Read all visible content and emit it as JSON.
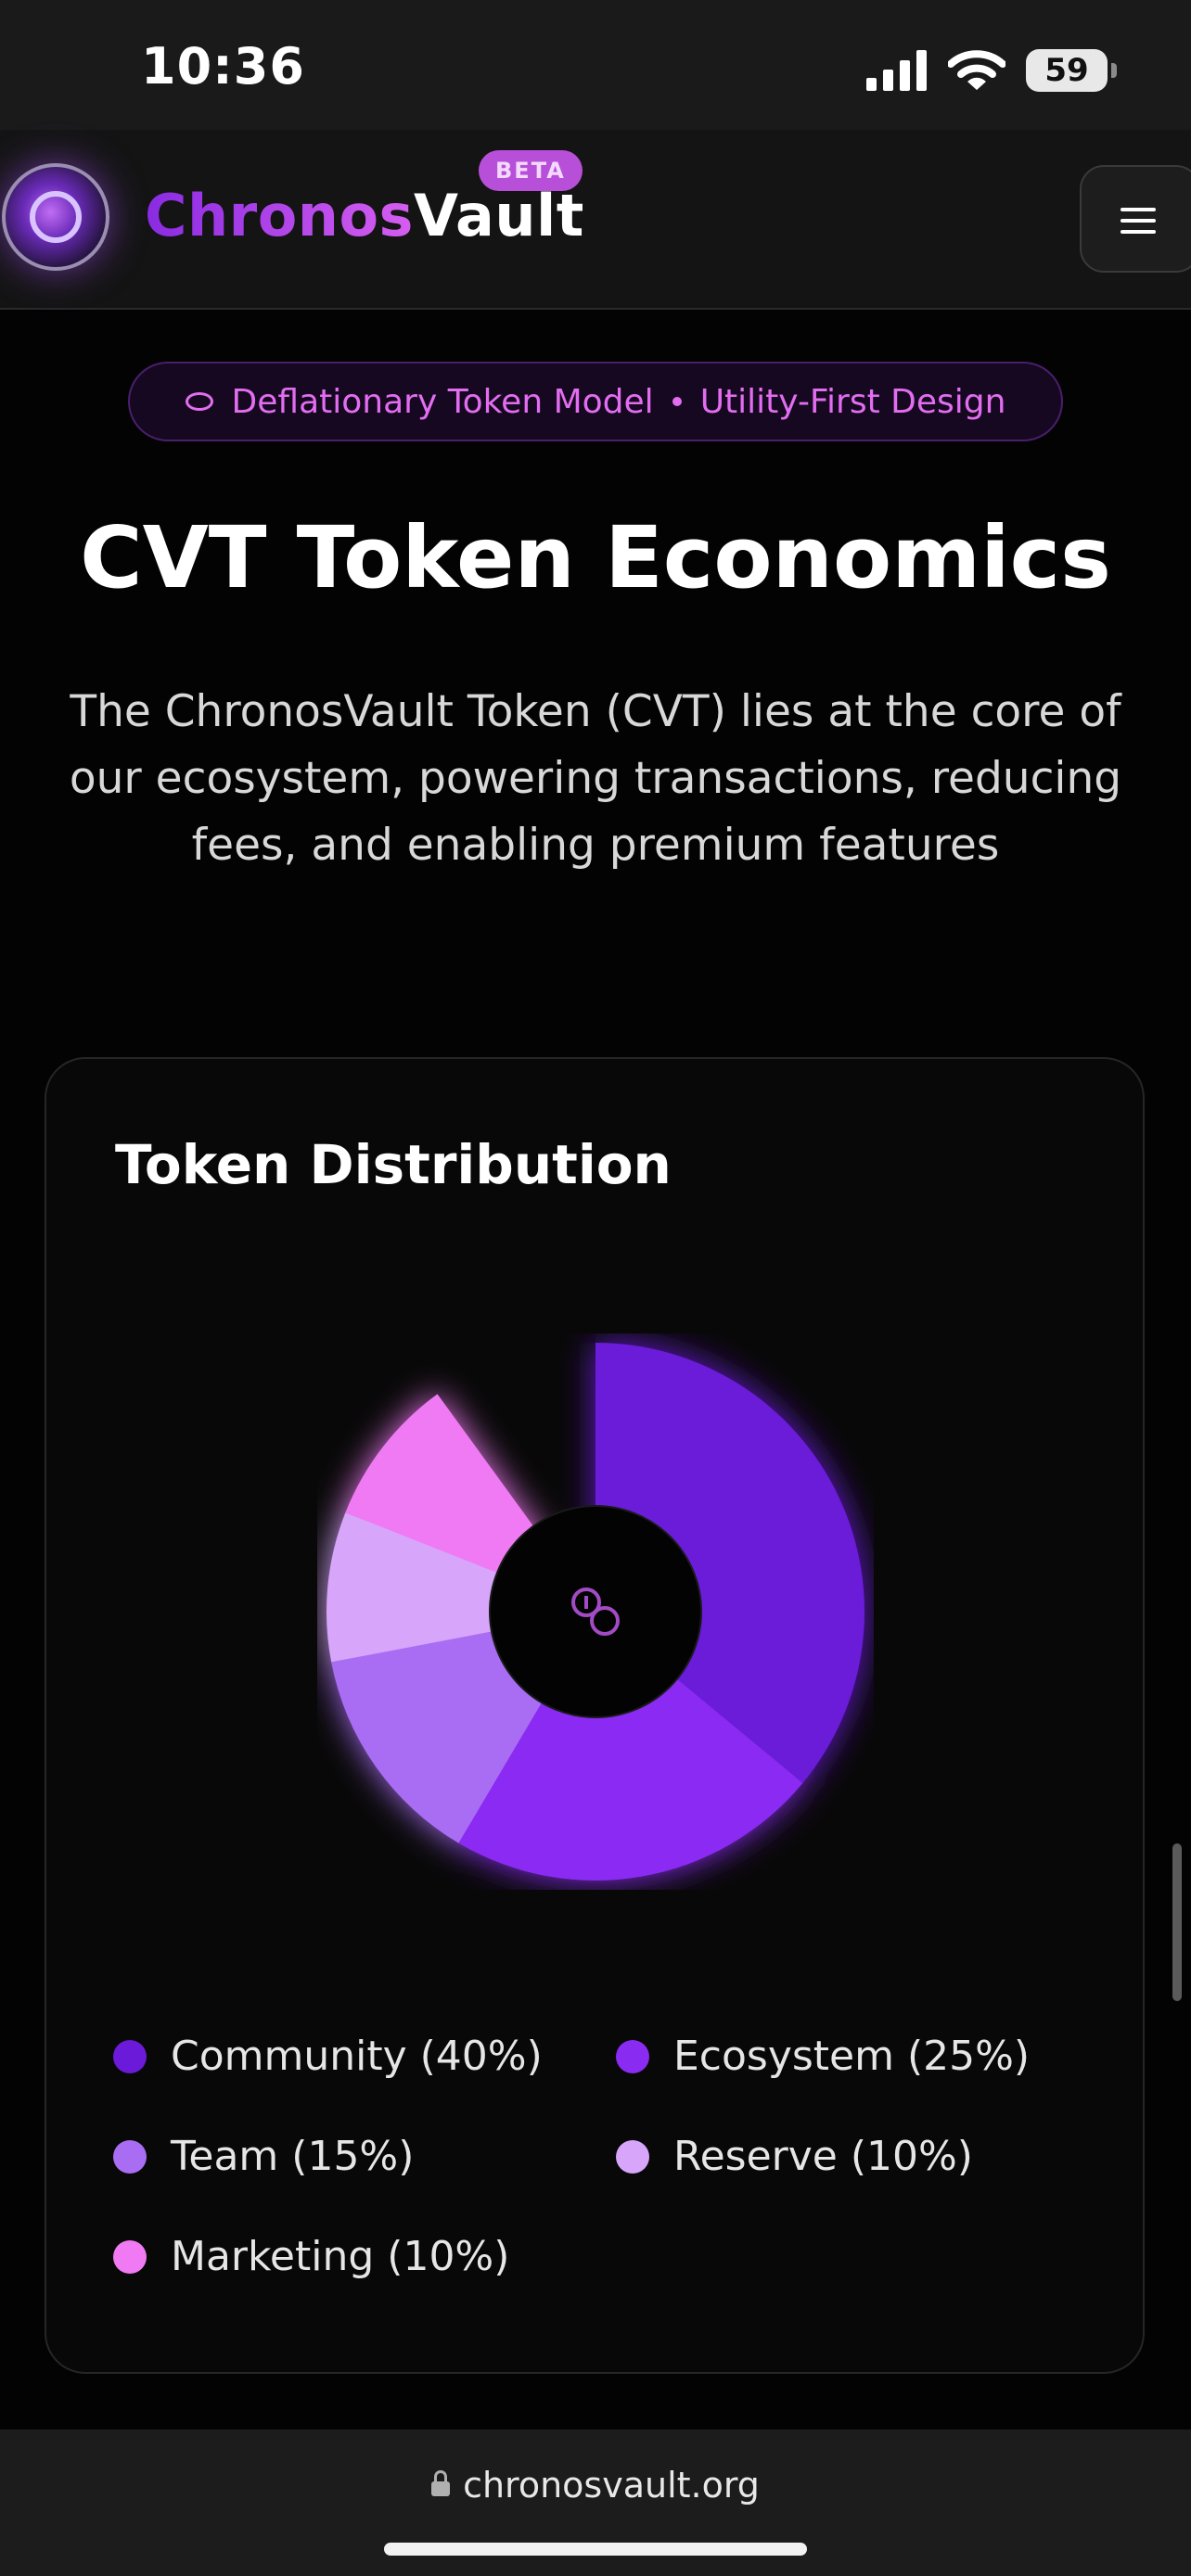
{
  "status_bar": {
    "time": "10:36",
    "battery": "59"
  },
  "header": {
    "brand_part1": "Chronos",
    "brand_part2": "Vault",
    "badge": "BETA"
  },
  "hero": {
    "badge_left": "Deflationary Token Model",
    "badge_right": "Utility-First Design",
    "title": "CVT Token Economics",
    "description": "The ChronosVault Token (CVT) lies at the core of our ecosystem, powering transactions, reducing fees, and enabling premium features"
  },
  "card": {
    "title": "Token Distribution",
    "legend": [
      {
        "label": "Community (40%)",
        "color": "#6a1ad8"
      },
      {
        "label": "Ecosystem (25%)",
        "color": "#8a2bf2"
      },
      {
        "label": "Team (15%)",
        "color": "#a96df4"
      },
      {
        "label": "Reserve (10%)",
        "color": "#d7a6fb"
      },
      {
        "label": "Marketing (10%)",
        "color": "#f07af3"
      }
    ]
  },
  "chart_data": {
    "type": "pie",
    "categories": [
      "Community",
      "Ecosystem",
      "Team",
      "Reserve",
      "Marketing"
    ],
    "values": [
      40,
      25,
      15,
      10,
      10
    ],
    "colors": [
      "#6a1ad8",
      "#8a2bf2",
      "#a96df4",
      "#d7a6fb",
      "#f07af3"
    ],
    "title": "Token Distribution"
  },
  "address_bar": {
    "url": "chronosvault.org"
  }
}
